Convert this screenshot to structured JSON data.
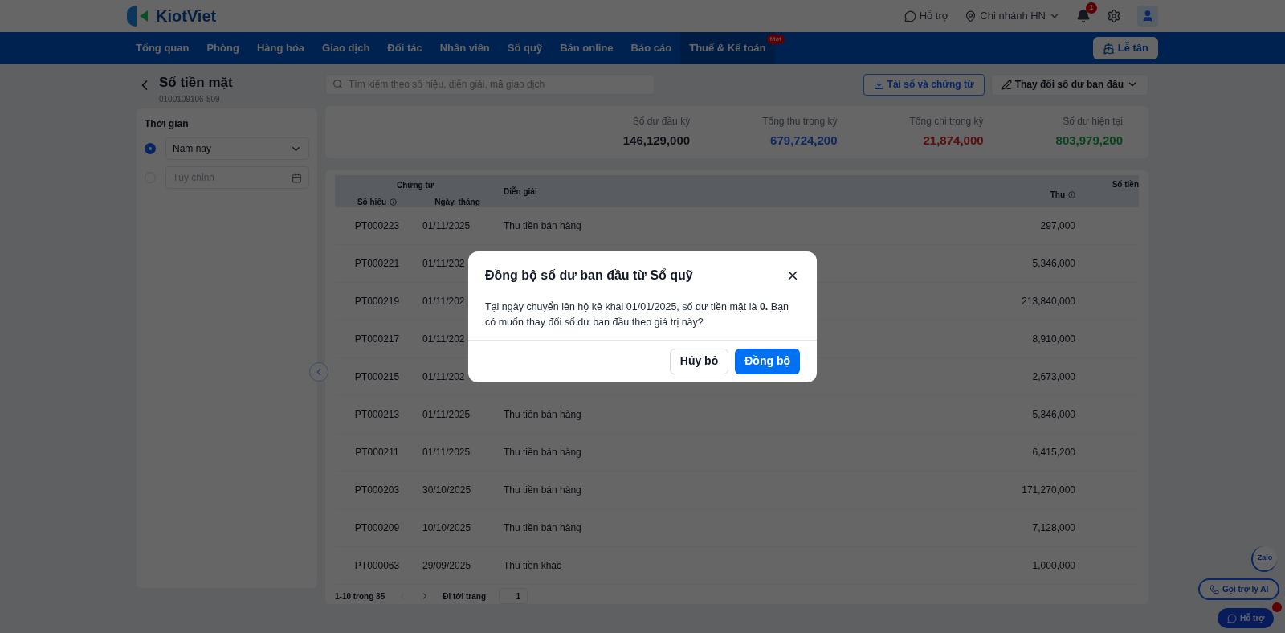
{
  "header": {
    "logo": "KiotViet",
    "support": "Hỗ trợ",
    "branch": "Chi nhánh HN",
    "notification_count": "1"
  },
  "nav": {
    "items": [
      {
        "label": "Tổng quan",
        "selected": false
      },
      {
        "label": "Phòng",
        "selected": false
      },
      {
        "label": "Hàng hóa",
        "selected": false
      },
      {
        "label": "Giao dịch",
        "selected": false
      },
      {
        "label": "Đối tác",
        "selected": false
      },
      {
        "label": "Nhân viên",
        "selected": false
      },
      {
        "label": "Sổ quỹ",
        "selected": false
      },
      {
        "label": "Bán online",
        "selected": false
      },
      {
        "label": "Báo cáo",
        "selected": false
      },
      {
        "label": "Thuế & Kế toán",
        "selected": true,
        "badge": "Mới"
      }
    ],
    "reception_button": "Lễ tân"
  },
  "page": {
    "title": "Số tiền mặt",
    "subtitle": "0100109106-509",
    "search": {
      "placeholder": "Tìm kiếm theo số hiệu, diễn giải, mã giao dịch"
    },
    "download_button": "Tải sổ và chứng từ",
    "change_button": "Thay đổi số dư ban đầu"
  },
  "filter": {
    "title": "Thời gian",
    "options": [
      {
        "kind": "select",
        "value": "Năm nay",
        "selected": true
      },
      {
        "kind": "date",
        "placeholder": "Tùy chỉnh",
        "selected": false
      }
    ]
  },
  "stats": [
    {
      "label": "Số dư đầu kỳ",
      "value": "146,129,000",
      "kind": "opening"
    },
    {
      "label": "Tổng thu trong kỳ",
      "value": "679,724,200",
      "kind": "income"
    },
    {
      "label": "Tổng chi trong kỳ",
      "value": "21,874,000",
      "kind": "expense"
    },
    {
      "label": "Số dư hiện tại",
      "value": "803,979,200",
      "kind": "balance"
    }
  ],
  "table": {
    "group_header": "Chứng từ",
    "columns": [
      "Số hiệu",
      "Ngày, tháng",
      "Diễn giải",
      "Thu",
      "Số tiền"
    ],
    "rows": [
      {
        "number": "PT000223",
        "date": "01/11/2025",
        "description": "Thu tiền bán hàng",
        "income": "297,000"
      },
      {
        "number": "PT000221",
        "date": "01/11/202",
        "income": "5,346,000"
      },
      {
        "number": "PT000219",
        "date": "01/11/202",
        "income": "213,840,000"
      },
      {
        "number": "PT000217",
        "date": "01/11/202",
        "income": "8,910,000"
      },
      {
        "number": "PT000215",
        "date": "01/11/202",
        "income": "2,673,000"
      },
      {
        "number": "PT000213",
        "date": "01/11/2025",
        "description": "Thu tiền bán hàng",
        "income": "5,346,000"
      },
      {
        "number": "PT000211",
        "date": "01/11/2025",
        "description": "Thu tiền bán hàng",
        "income": "6,415,200"
      },
      {
        "number": "PT000203",
        "date": "30/10/2025",
        "description": "Thu tiền bán hàng",
        "income": "171,270,000"
      },
      {
        "number": "PT000209",
        "date": "10/10/2025",
        "description": "Thu tiền bán hàng",
        "income": "7,128,000"
      },
      {
        "number": "PT000063",
        "date": "29/09/2025",
        "description": "Thu tiền khác",
        "income": "1,000,000"
      }
    ],
    "pagination": {
      "range": "1-10 trong 35",
      "goto_label": "Đi tới trang",
      "page": "1"
    }
  },
  "floating": {
    "zalo": "Zalo",
    "ai_button": "Gọi trợ lý AI",
    "support_button": "Hỗ trợ"
  },
  "dialog": {
    "title": "Đồng bộ số dư ban đầu từ Sổ quỹ",
    "message": "Tại ngày chuyển lên hộ kê khai 01/01/2025, số dư tiền mặt là **0.** Bạn có muốn thay đổi số dư ban đầu theo giá trị này?",
    "cancel": "Hủy bỏ",
    "confirm": "Đồng bộ"
  }
}
